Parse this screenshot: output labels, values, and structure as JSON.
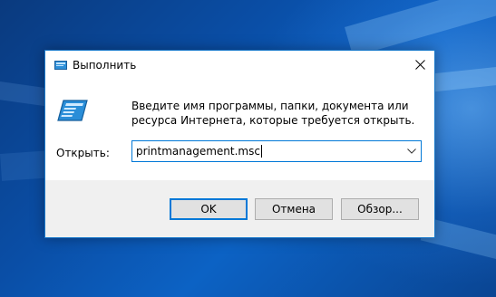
{
  "dialog": {
    "title": "Выполнить",
    "description": "Введите имя программы, папки, документа или ресурса Интернета, которые требуется открыть.",
    "open_label": "Открыть:",
    "open_value": "printmanagement.msc",
    "buttons": {
      "ok": "OK",
      "cancel": "Отмена",
      "browse": "Обзор..."
    }
  },
  "icons": {
    "title": "run-icon",
    "close": "close-icon",
    "dropdown": "chevron-down-icon",
    "main": "run-icon"
  },
  "colors": {
    "accent": "#0078d7",
    "footer": "#f0f0f0",
    "button": "#e1e1e1",
    "desktop": "#0b4ea6"
  }
}
